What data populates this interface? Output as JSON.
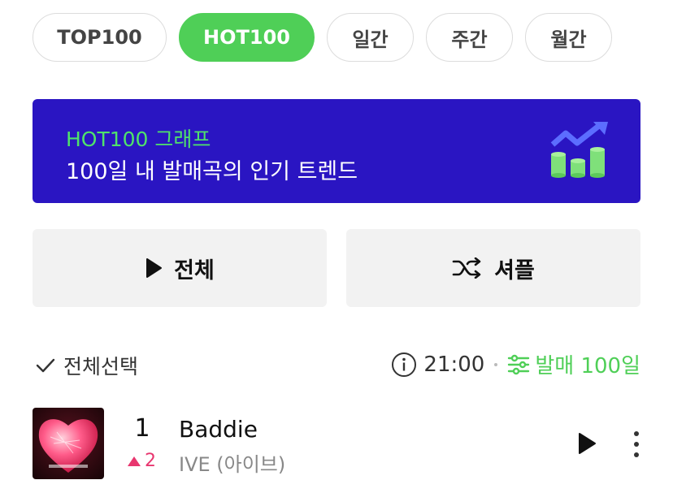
{
  "tabs": [
    {
      "label": "TOP100"
    },
    {
      "label": "HOT100"
    },
    {
      "label": "일간"
    },
    {
      "label": "주간"
    },
    {
      "label": "월간"
    }
  ],
  "active_tab": "HOT100",
  "banner": {
    "title": "HOT100 그래프",
    "subtitle": "100일 내 발매곡의 인기 트렌드",
    "background": "#2a15c2",
    "title_color": "#4fe36a"
  },
  "actions": {
    "play_all_label": "전체",
    "shuffle_label": "셔플"
  },
  "list_bar": {
    "select_all_label": "전체선택",
    "time": "21:00",
    "filter_label": "발매 100일"
  },
  "songs": [
    {
      "rank": "1",
      "change": "2",
      "change_direction": "up",
      "title": "Baddie",
      "artist": "IVE (아이브)"
    }
  ],
  "colors": {
    "accent": "#4fcf57",
    "rank_up": "#e8366f"
  }
}
